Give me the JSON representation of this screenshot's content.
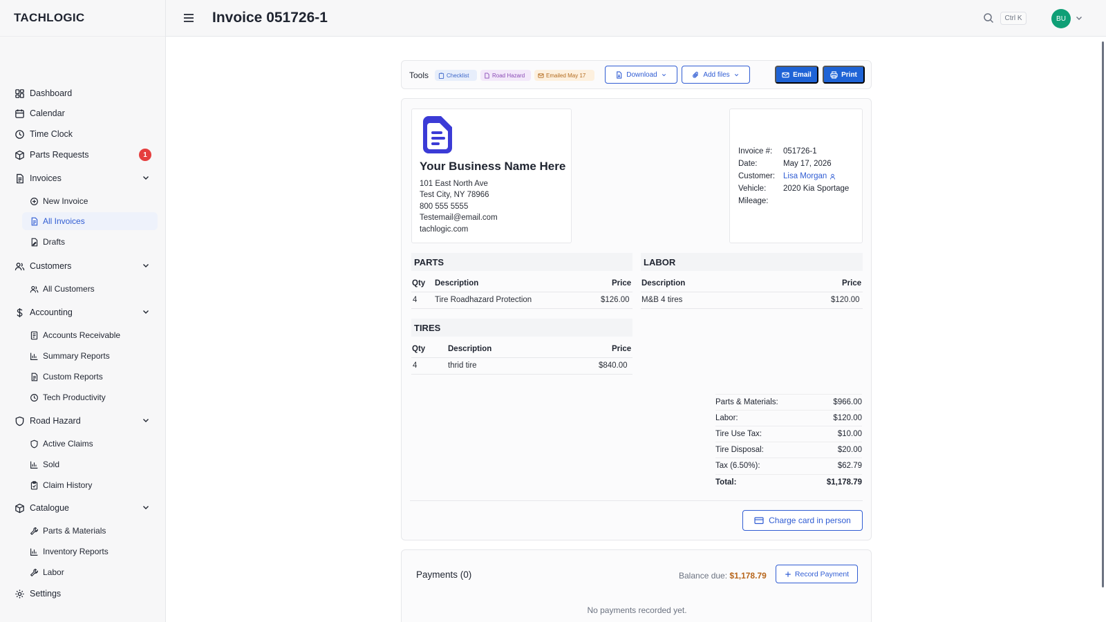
{
  "brand": "TACHLOGIC",
  "header": {
    "title": "Invoice 051726-1",
    "kbd": "Ctrl K",
    "avatar": "BU"
  },
  "sidebar": {
    "items": [
      {
        "label": "Dashboard",
        "icon": "dashboard-icon"
      },
      {
        "label": "Calendar",
        "icon": "calendar-icon"
      },
      {
        "label": "Time Clock",
        "icon": "clock-icon"
      },
      {
        "label": "Parts Requests",
        "icon": "box-icon",
        "badge": "1"
      },
      {
        "label": "Invoices",
        "icon": "document-icon"
      },
      {
        "label": "New Invoice",
        "icon": "plus-circle-icon"
      },
      {
        "label": "All Invoices",
        "icon": "document-icon"
      },
      {
        "label": "Drafts",
        "icon": "draft-icon"
      },
      {
        "label": "Customers",
        "icon": "users-icon"
      },
      {
        "label": "All Customers",
        "icon": "users-icon"
      },
      {
        "label": "Accounting",
        "icon": "dollar-icon"
      },
      {
        "label": "Accounts Receivable",
        "icon": "receipt-icon"
      },
      {
        "label": "Summary Reports",
        "icon": "bar-chart-icon"
      },
      {
        "label": "Custom Reports",
        "icon": "document-icon"
      },
      {
        "label": "Tech Productivity",
        "icon": "clock-icon"
      },
      {
        "label": "Road Hazard",
        "icon": "shield-icon"
      },
      {
        "label": "Active Claims",
        "icon": "shield-icon"
      },
      {
        "label": "Sold",
        "icon": "bar-chart-icon"
      },
      {
        "label": "Claim History",
        "icon": "clipboard-icon"
      },
      {
        "label": "Catalogue",
        "icon": "box-icon"
      },
      {
        "label": "Parts & Materials",
        "icon": "wrench-icon"
      },
      {
        "label": "Inventory Reports",
        "icon": "bar-chart-icon"
      },
      {
        "label": "Labor",
        "icon": "wrench-icon"
      },
      {
        "label": "Settings",
        "icon": "gear-icon"
      }
    ]
  },
  "tools": {
    "label": "Tools",
    "chips": {
      "checklist": "Checklist",
      "road_hazard": "Road Hazard",
      "emailed": "Emailed May 17"
    },
    "download": "Download",
    "add_files": "Add files",
    "email": "Email",
    "print": "Print"
  },
  "business": {
    "name": "Your Business Name Here",
    "address1": "101 East North Ave",
    "address2": "Test City, NY 78966",
    "phone": "800 555 5555",
    "email": "Testemail@email.com",
    "website": "tachlogic.com"
  },
  "invoice_meta": {
    "number_label": "Invoice #:",
    "number": "051726-1",
    "date_label": "Date:",
    "date": "May 17, 2026",
    "customer_label": "Customer:",
    "customer": "Lisa Morgan",
    "vehicle_label": "Vehicle:",
    "vehicle": "2020 Kia Sportage",
    "mileage_label": "Mileage:",
    "mileage": ""
  },
  "parts": {
    "title": "PARTS",
    "headers": {
      "qty": "Qty",
      "description": "Description",
      "price": "Price"
    },
    "rows": [
      {
        "qty": "4",
        "description": "Tire Roadhazard Protection",
        "price": "$126.00"
      }
    ]
  },
  "labor": {
    "title": "LABOR",
    "headers": {
      "description": "Description",
      "price": "Price"
    },
    "rows": [
      {
        "description": "M&B 4 tires",
        "price": "$120.00"
      }
    ]
  },
  "tires": {
    "title": "TIRES",
    "headers": {
      "qty": "Qty",
      "description": "Description",
      "price": "Price"
    },
    "rows": [
      {
        "qty": "4",
        "description": "thrid tire",
        "price": "$840.00"
      }
    ]
  },
  "summary": [
    {
      "label": "Parts & Materials:",
      "value": "$966.00"
    },
    {
      "label": "Labor:",
      "value": "$120.00"
    },
    {
      "label": "Tire Use Tax:",
      "value": "$10.00"
    },
    {
      "label": "Tire Disposal:",
      "value": "$20.00"
    },
    {
      "label": "Tax (6.50%):",
      "value": "$62.79"
    },
    {
      "label": "Total:",
      "value": "$1,178.79"
    }
  ],
  "charge_button": "Charge card in person",
  "payments": {
    "title": "Payments (0)",
    "balance_label": "Balance due:",
    "balance": "$1,178.79",
    "record_button": "Record Payment",
    "empty": "No payments recorded yet."
  },
  "colors": {
    "accent": "#1e63d6",
    "badge": "#e53e3e",
    "avatar": "#0f9f76",
    "balance": "#b7651a"
  }
}
